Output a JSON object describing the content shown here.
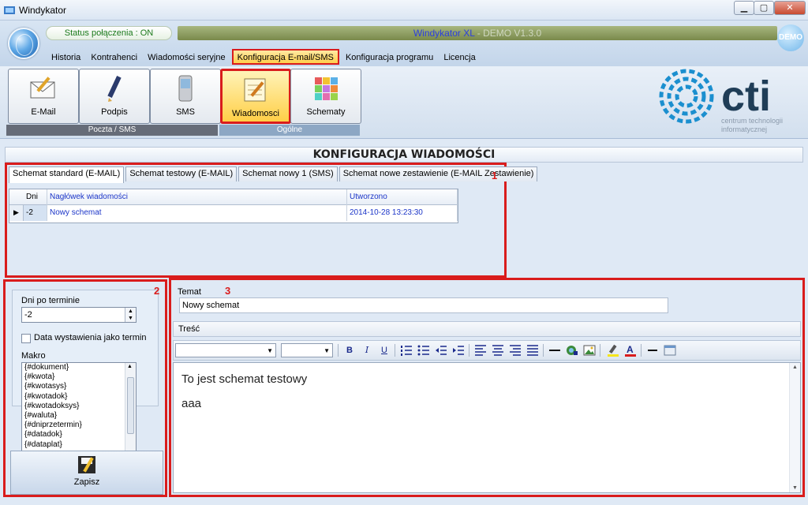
{
  "window": {
    "title": "Windykator",
    "min_label": "▁",
    "max_label": "▢",
    "close_label": "✕"
  },
  "header": {
    "status": "Status połączenia : ON",
    "brand_name": "Windykator XL",
    "brand_version": " - DEMO V1.3.0",
    "demo_badge": "DEMO"
  },
  "menu": {
    "items": [
      "Historia",
      "Kontrahenci",
      "Wiadomości seryjne",
      "Konfiguracja E-mail/SMS",
      "Konfiguracja programu",
      "Licencja"
    ],
    "active_index": 3
  },
  "toolbar": {
    "buttons": [
      {
        "label": "E-Mail",
        "icon": "email-icon"
      },
      {
        "label": "Podpis",
        "icon": "pen-icon"
      },
      {
        "label": "SMS",
        "icon": "phone-icon"
      },
      {
        "label": "Wiadomosci",
        "icon": "notepad-icon"
      },
      {
        "label": "Schematy",
        "icon": "grid-icon"
      }
    ],
    "groups": [
      "Poczta / SMS",
      "Ogólne"
    ]
  },
  "logo": {
    "name": "cti",
    "line1": "centrum technologii",
    "line2": "informatycznej"
  },
  "section": {
    "title": "KONFIGURACJA WIADOMOŚCI"
  },
  "annotations": [
    "1",
    "2",
    "3"
  ],
  "tabs": [
    "Schemat standard (E-MAIL)",
    "Schemat testowy (E-MAIL)",
    "Schemat nowy 1 (SMS)",
    "Schemat nowe zestawienie (E-MAIL Zestawienie)"
  ],
  "grid": {
    "headers": [
      "Dni",
      "Nagłówek wiadomości",
      "Utworzono"
    ],
    "rows": [
      {
        "dni": "-2",
        "naglowek": "Nowy schemat",
        "utworzono": "2014-10-28 13:23:30"
      }
    ]
  },
  "left": {
    "dni_label": "Dni po terminie",
    "dni_value": "-2",
    "checkbox_label": "Data wystawienia jako termin",
    "checkbox_checked": false,
    "makro_label": "Makro",
    "makro_items": [
      "{#dokument}",
      "{#kwota}",
      "{#kwotasys}",
      "{#kwotadok}",
      "{#kwotadoksys}",
      "{#waluta}",
      "{#dniprzetermin}",
      "{#datadok}",
      "{#dataplat}"
    ],
    "save_label": "Zapisz"
  },
  "right": {
    "temat_label": "Temat",
    "temat_value": "Nowy schemat",
    "tresc_label": "Treść",
    "body_lines": [
      "To jest schemat testowy",
      "aaa"
    ]
  },
  "colors": {
    "accent_red": "#d91c1c",
    "link_blue": "#1b35c8",
    "logo_blue": "#1b8fcf"
  }
}
